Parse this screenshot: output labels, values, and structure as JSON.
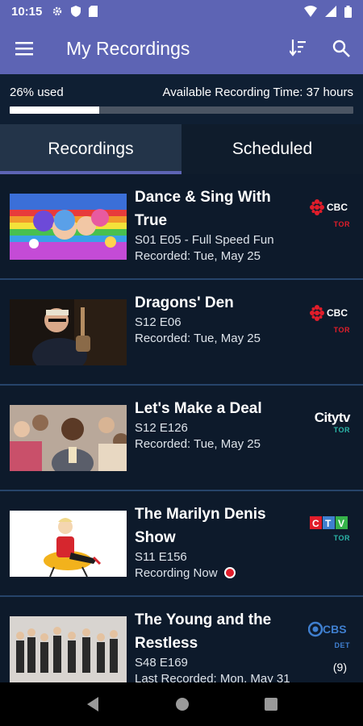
{
  "status_bar": {
    "time": "10:15"
  },
  "app_bar": {
    "title": "My Recordings"
  },
  "storage": {
    "used_label": "26% used",
    "available_label": "Available Recording Time: 37 hours",
    "used_fraction": 0.26
  },
  "tabs": [
    {
      "label": "Recordings",
      "active": true
    },
    {
      "label": "Scheduled",
      "active": false
    }
  ],
  "recordings": [
    {
      "title": "Dance & Sing With True",
      "episode": "S01 E05 - Full Speed Fun",
      "status": "Recorded: Tue, May 25",
      "channel_name": "CBC",
      "channel_sub": "TOR"
    },
    {
      "title": "Dragons' Den",
      "episode": "S12 E06",
      "status": "Recorded: Tue, May 25",
      "channel_name": "CBC",
      "channel_sub": "TOR"
    },
    {
      "title": "Let's Make a Deal",
      "episode": "S12 E126",
      "status": "Recorded: Tue, May 25",
      "channel_name": "Citytv",
      "channel_sub": "TOR"
    },
    {
      "title": "The Marilyn Denis Show",
      "episode": "S11 E156",
      "status": "Recording Now",
      "channel_name": "CTV",
      "channel_sub": "TOR",
      "recording_now": true
    },
    {
      "title": "The Young and the Restless",
      "episode": "S48 E169",
      "status": "Last Recorded: Mon, May 31",
      "channel_name": "CBS",
      "channel_sub": "DET",
      "count": "(9)"
    }
  ],
  "icons": {
    "menu": "hamburger-icon",
    "sort": "sort-icon",
    "search": "search-icon",
    "back": "back-icon",
    "home": "home-icon",
    "recents": "recents-icon"
  },
  "colors": {
    "accent": "#5d64b4",
    "background": "#0d1a2b",
    "record_red": "#e11d2a",
    "cbc_red": "#e11d2a"
  }
}
